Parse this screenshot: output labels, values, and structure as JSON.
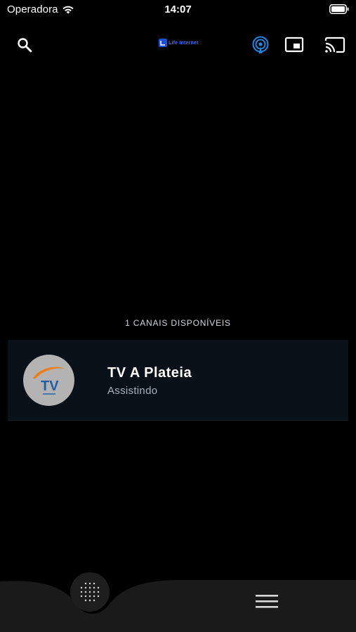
{
  "status_bar": {
    "carrier": "Operadora",
    "time": "14:07"
  },
  "toolbar": {
    "logo_text": "Life Internet",
    "icons": [
      "search-icon",
      "podcast-icon",
      "picture-in-picture-icon",
      "cast-icon"
    ],
    "accent_color": "#1e88e5"
  },
  "channels": {
    "count_label": "1 CANAIS DISPONÍVEIS",
    "items": [
      {
        "name": "TV A Plateia",
        "status": "Assistindo",
        "logo_text": "TV"
      }
    ]
  },
  "bottom_nav": {
    "icons": [
      "grid-dots-icon",
      "hamburger-menu-icon"
    ]
  }
}
